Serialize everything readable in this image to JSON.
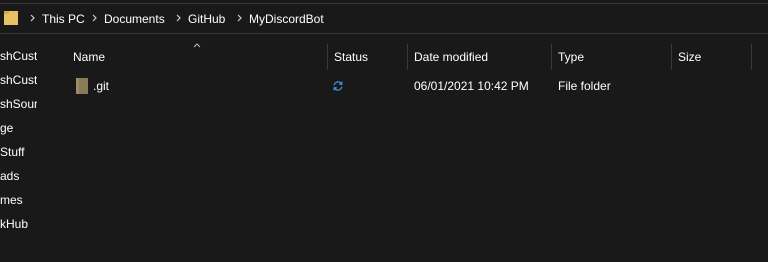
{
  "address_bar": {
    "crumbs": [
      "This PC",
      "Documents",
      "GitHub",
      "MyDiscordBot"
    ],
    "folder_icon": "folder-icon",
    "separator_icon": "chevron-right-icon"
  },
  "sidebar": {
    "items": [
      {
        "label": "shCust"
      },
      {
        "label": "shCust"
      },
      {
        "label": "shSour"
      },
      {
        "label": "ge"
      },
      {
        "label": "Stuff"
      },
      {
        "label": "ads"
      },
      {
        "label": "mes"
      },
      {
        "label": "kHub"
      }
    ]
  },
  "columns": [
    {
      "label": "Name"
    },
    {
      "label": "Status"
    },
    {
      "label": "Date modified"
    },
    {
      "label": "Type"
    },
    {
      "label": "Size"
    }
  ],
  "files": [
    {
      "name": ".git",
      "status_icon": "sync-icon",
      "date_modified": "06/01/2021 10:42 PM",
      "type": "File folder",
      "size": ""
    }
  ],
  "colors": {
    "background": "#191919",
    "text": "#ffffff",
    "folder": "#8a7a58",
    "sync": "#3a8fd9",
    "divider": "#3a3a3a"
  }
}
